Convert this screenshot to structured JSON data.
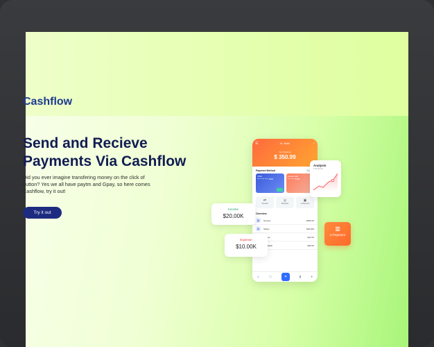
{
  "brand": "Cashflow",
  "hero": {
    "headline_line1": "Send and Recieve",
    "headline_line2": "Payments Via Cashflow",
    "description": "Did you ever imagine transfering money on the click of button? Yes we all have paytm and Gpay, so here comes Cashflow, try it out!",
    "cta_label": "Try it out"
  },
  "phone": {
    "greeting": "Hi, Smith",
    "balance_label": "Your Balance",
    "balance": "$ 350.99",
    "payment_method_label": "Payment Method",
    "see_all": "See All",
    "cards": [
      {
        "brand": "VISA",
        "number": "**** **** **** 2564"
      },
      {
        "brand": "MasterCard",
        "number": "**** **** 3256"
      }
    ],
    "quick_actions": [
      {
        "label": "Transfer",
        "icon": "transfer-icon"
      },
      {
        "label": "Rewards",
        "icon": "rewards-icon"
      },
      {
        "label": "e-Payment",
        "icon": "epayment-icon"
      }
    ],
    "overview_label": "Overview",
    "transactions": [
      {
        "name": "Grocery",
        "amount": "-$300.00"
      },
      {
        "name": "Salary",
        "amount": "$20,000"
      },
      {
        "name": "Movies",
        "amount": "-$12.00"
      },
      {
        "name": "Car Wash",
        "amount": "-$30.00"
      }
    ],
    "nav_icons": [
      "home-icon",
      "wallet-icon",
      "scan-icon",
      "chart-icon",
      "profile-icon"
    ]
  },
  "income": {
    "label": "Income",
    "value": "$20.00K"
  },
  "expense": {
    "label": "Expense",
    "value": "$10.00K"
  },
  "analysis": {
    "title": "Analysis",
    "subtitle": "This Month"
  },
  "epayment": {
    "label": "e-Payment"
  },
  "colors": {
    "brand_blue": "#1c3a8f",
    "headline": "#111c52",
    "cta_bg": "#1d2b80",
    "accent_orange": "#ff7a2a",
    "income_green": "#1aa860",
    "expense_red": "#e63b3b"
  }
}
